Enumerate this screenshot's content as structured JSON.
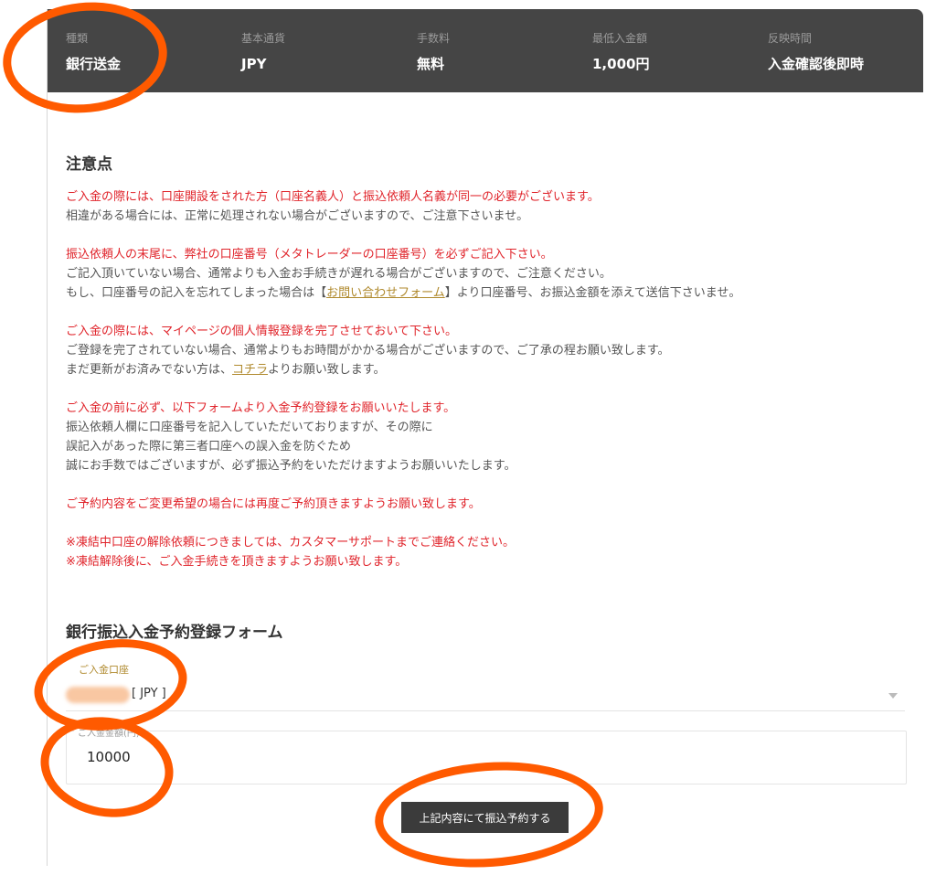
{
  "header": {
    "columns": [
      {
        "label": "種類",
        "value": "銀行送金"
      },
      {
        "label": "基本通貨",
        "value": "JPY"
      },
      {
        "label": "手数料",
        "value": "無料"
      },
      {
        "label": "最低入金額",
        "value": "1,000円"
      },
      {
        "label": "反映時間",
        "value": "入金確認後即時"
      }
    ]
  },
  "notes": {
    "title": "注意点",
    "p1": {
      "l1": "ご入金の際には、口座開設をされた方（口座名義人）と振込依頼人名義が同一の必要がございます。",
      "l2": "相違がある場合には、正常に処理されない場合がございますので、ご注意下さいませ。"
    },
    "p2": {
      "l1": "振込依頼人の末尾に、弊社の口座番号（メタトレーダーの口座番号）を必ずご記入下さい。",
      "l2": "ご記入頂いていない場合、通常よりも入金お手続きが遅れる場合がございますので、ご注意ください。",
      "l3_pre": "もし、口座番号の記入を忘れてしまった場合は【",
      "l3_link": "お問い合わせフォーム",
      "l3_post": "】より口座番号、お振込金額を添えて送信下さいませ。"
    },
    "p3": {
      "l1": "ご入金の際には、マイページの個人情報登録を完了させておいて下さい。",
      "l2": "ご登録を完了されていない場合、通常よりもお時間がかかる場合がございますので、ご了承の程お願い致します。",
      "l3_pre": "まだ更新がお済みでない方は、",
      "l3_link": "コチラ",
      "l3_post": "よりお願い致します。"
    },
    "p4": {
      "l1": "ご入金の前に必ず、以下フォームより入金予約登録をお願いいたします。",
      "l2": "振込依頼人欄に口座番号を記入していただいておりますが、その際に",
      "l3": "誤記入があった際に第三者口座への誤入金を防ぐため",
      "l4": "誠にお手数ではございますが、必ず振込予約をいただけますようお願いいたします。"
    },
    "p5": {
      "l1": "ご予約内容をご変更希望の場合には再度ご予約頂きますようお願い致します。"
    },
    "p6": {
      "l1": "※凍結中口座の解除依頼につきましては、カスタマーサポートまでご連絡ください。",
      "l2": "※凍結解除後に、ご入金手続きを頂きますようお願い致します。"
    }
  },
  "form": {
    "title": "銀行振込入金予約登録フォーム",
    "account_label": "ご入金口座",
    "account_currency": "[ JPY ]",
    "amount_label": "ご入金金額(円)",
    "amount_value": "10000",
    "submit_label": "上記内容にて振込予約する"
  },
  "colors": {
    "header_bg": "#454545",
    "warning_red": "#e0242b",
    "link_gold": "#b08a2e",
    "button_bg": "#3b3b3b",
    "annotation_orange": "#ff5a00"
  }
}
